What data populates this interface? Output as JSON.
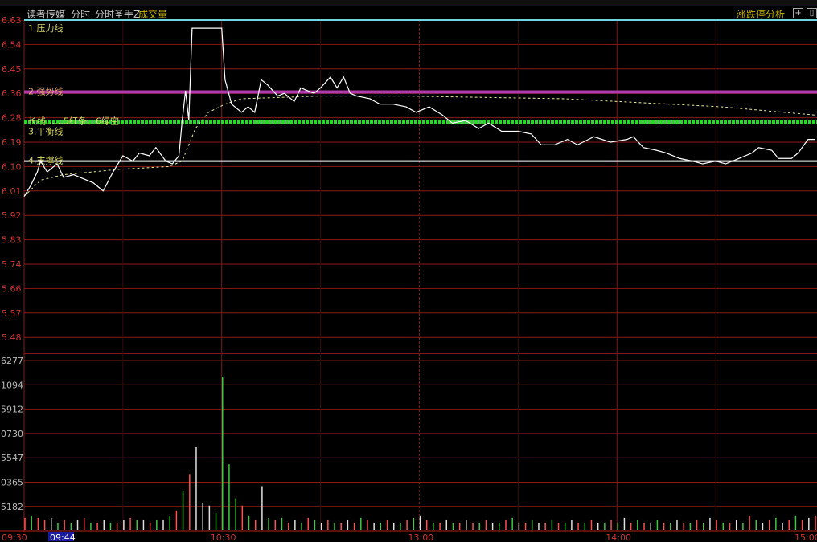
{
  "header": {
    "stock_name": "读者传媒",
    "view": "分时",
    "indicator": "分时圣手Z",
    "volume_label": "成交量",
    "right_link": "涨跌停分析"
  },
  "chart_data": {
    "type": "line",
    "title": "读者传媒 分时",
    "price_ticks": [
      "6.63",
      "6.54",
      "6.45",
      "6.36",
      "6.28",
      "6.19",
      "6.10",
      "6.01",
      "5.92",
      "5.83",
      "5.74",
      "5.66",
      "5.57",
      "5.48"
    ],
    "ylim": [
      5.455,
      6.63
    ],
    "volume_ticks": [
      "6277",
      "1094",
      "5912",
      "0730",
      "5547",
      "0365",
      "5182"
    ],
    "time_ticks": [
      {
        "label": "09:30",
        "minute": 0
      },
      {
        "label": "09:44",
        "minute": 14,
        "highlight": true
      },
      {
        "label": "10:30",
        "minute": 60
      },
      {
        "label": "13:00",
        "minute": 120
      },
      {
        "label": "14:00",
        "minute": 180
      },
      {
        "label": "15:00",
        "minute": 240
      }
    ],
    "levels": [
      {
        "label": "1.压力线",
        "price": 6.63,
        "color": "#6fd6e0",
        "label_color": "#d8d86a"
      },
      {
        "label": "2.强势线",
        "price": 6.365,
        "color": "#b03aa8",
        "label_color": "#e0a070"
      },
      {
        "label": "长线……5红条、6绿空",
        "price": 6.255,
        "color": "#2fd42f",
        "label_color": "#d8d86a"
      },
      {
        "label": "3.平衡线",
        "price": 6.24,
        "color": "none",
        "label_color": "#d8d86a"
      },
      {
        "label": "4.支撑线",
        "price": 6.11,
        "color": "#ffffff",
        "label_color": "#d8d86a"
      }
    ],
    "price_series": [
      [
        0,
        5.98
      ],
      [
        2,
        6.02
      ],
      [
        4,
        6.07
      ],
      [
        5,
        6.11
      ],
      [
        7,
        6.07
      ],
      [
        10,
        6.1
      ],
      [
        12,
        6.05
      ],
      [
        15,
        6.06
      ],
      [
        17,
        6.05
      ],
      [
        21,
        6.03
      ],
      [
        24,
        6.0
      ],
      [
        27,
        6.07
      ],
      [
        30,
        6.13
      ],
      [
        33,
        6.11
      ],
      [
        35,
        6.14
      ],
      [
        38,
        6.13
      ],
      [
        40,
        6.16
      ],
      [
        43,
        6.11
      ],
      [
        45,
        6.1
      ],
      [
        47,
        6.13
      ],
      [
        48,
        6.26
      ],
      [
        49,
        6.37
      ],
      [
        50,
        6.26
      ],
      [
        51,
        6.6
      ],
      [
        60,
        6.6
      ],
      [
        61,
        6.41
      ],
      [
        63,
        6.32
      ],
      [
        66,
        6.29
      ],
      [
        68,
        6.31
      ],
      [
        70,
        6.29
      ],
      [
        72,
        6.41
      ],
      [
        74,
        6.39
      ],
      [
        77,
        6.35
      ],
      [
        79,
        6.36
      ],
      [
        82,
        6.33
      ],
      [
        84,
        6.38
      ],
      [
        88,
        6.36
      ],
      [
        90,
        6.38
      ],
      [
        93,
        6.42
      ],
      [
        95,
        6.38
      ],
      [
        97,
        6.42
      ],
      [
        99,
        6.36
      ],
      [
        101,
        6.35
      ],
      [
        105,
        6.34
      ],
      [
        108,
        6.32
      ],
      [
        112,
        6.32
      ],
      [
        116,
        6.31
      ],
      [
        119,
        6.29
      ],
      [
        123,
        6.31
      ],
      [
        127,
        6.28
      ],
      [
        130,
        6.25
      ],
      [
        134,
        6.26
      ],
      [
        138,
        6.23
      ],
      [
        141,
        6.25
      ],
      [
        145,
        6.22
      ],
      [
        150,
        6.22
      ],
      [
        154,
        6.21
      ],
      [
        157,
        6.17
      ],
      [
        161,
        6.17
      ],
      [
        165,
        6.19
      ],
      [
        168,
        6.17
      ],
      [
        173,
        6.2
      ],
      [
        178,
        6.18
      ],
      [
        183,
        6.19
      ],
      [
        185,
        6.2
      ],
      [
        188,
        6.16
      ],
      [
        192,
        6.15
      ],
      [
        195,
        6.14
      ],
      [
        199,
        6.12
      ],
      [
        203,
        6.11
      ],
      [
        206,
        6.1
      ],
      [
        210,
        6.11
      ],
      [
        213,
        6.1
      ],
      [
        217,
        6.12
      ],
      [
        221,
        6.14
      ],
      [
        223,
        6.16
      ],
      [
        227,
        6.15
      ],
      [
        229,
        6.12
      ],
      [
        233,
        6.12
      ],
      [
        235,
        6.14
      ],
      [
        238,
        6.19
      ],
      [
        240,
        6.19
      ]
    ],
    "avg_series": [
      [
        0,
        5.98
      ],
      [
        5,
        6.04
      ],
      [
        12,
        6.06
      ],
      [
        29,
        6.08
      ],
      [
        44,
        6.09
      ],
      [
        48,
        6.11
      ],
      [
        52,
        6.23
      ],
      [
        56,
        6.29
      ],
      [
        61,
        6.32
      ],
      [
        66,
        6.34
      ],
      [
        90,
        6.35
      ],
      [
        115,
        6.35
      ],
      [
        164,
        6.34
      ],
      [
        212,
        6.31
      ],
      [
        240,
        6.28
      ]
    ],
    "volume_step_minutes": 2,
    "volume_units_max": 7,
    "volume": [
      0.5,
      0.6,
      0.5,
      0.4,
      0.5,
      0.3,
      0.4,
      0.3,
      0.4,
      0.5,
      0.3,
      0.3,
      0.4,
      0.3,
      0.3,
      0.4,
      0.5,
      0.4,
      0.4,
      0.3,
      0.4,
      0.4,
      0.6,
      0.8,
      1.6,
      2.3,
      3.4,
      1.1,
      1.0,
      0.7,
      6.3,
      2.7,
      1.3,
      1.0,
      0.6,
      0.4,
      1.8,
      0.5,
      0.4,
      0.5,
      0.3,
      0.4,
      0.3,
      0.5,
      0.4,
      0.3,
      0.4,
      0.3,
      0.3,
      0.4,
      0.3,
      0.5,
      0.4,
      0.3,
      0.3,
      0.4,
      0.3,
      0.3,
      0.4,
      0.5,
      0.6,
      0.4,
      0.3,
      0.3,
      0.4,
      0.3,
      0.3,
      0.4,
      0.3,
      0.3,
      0.4,
      0.3,
      0.3,
      0.4,
      0.5,
      0.3,
      0.3,
      0.4,
      0.3,
      0.3,
      0.4,
      0.3,
      0.3,
      0.4,
      0.3,
      0.3,
      0.4,
      0.3,
      0.3,
      0.4,
      0.3,
      0.5,
      0.3,
      0.4,
      0.3,
      0.3,
      0.4,
      0.3,
      0.3,
      0.4,
      0.3,
      0.3,
      0.4,
      0.3,
      0.5,
      0.4,
      0.3,
      0.3,
      0.4,
      0.3,
      0.6,
      0.4,
      0.3,
      0.4,
      0.5,
      0.3,
      0.4,
      0.6,
      0.4,
      0.5,
      0.6
    ],
    "volume_colors": "rgrrwgrgwrgrwgrwrgwrgwgrgrwwwggggrgrwgrgrwgrgwrgrwrgrwgrwgrgwrgrwgrwrgrwgrgwrgwrgrgwrgrwgrgwrgrwgrgwrgrgwrgrwgrgwrgwrgrw",
    "colors": {
      "up": "#ff5050",
      "down": "#40c840",
      "flat": "#e0e0e0",
      "grid": "#8a1a1a"
    }
  }
}
